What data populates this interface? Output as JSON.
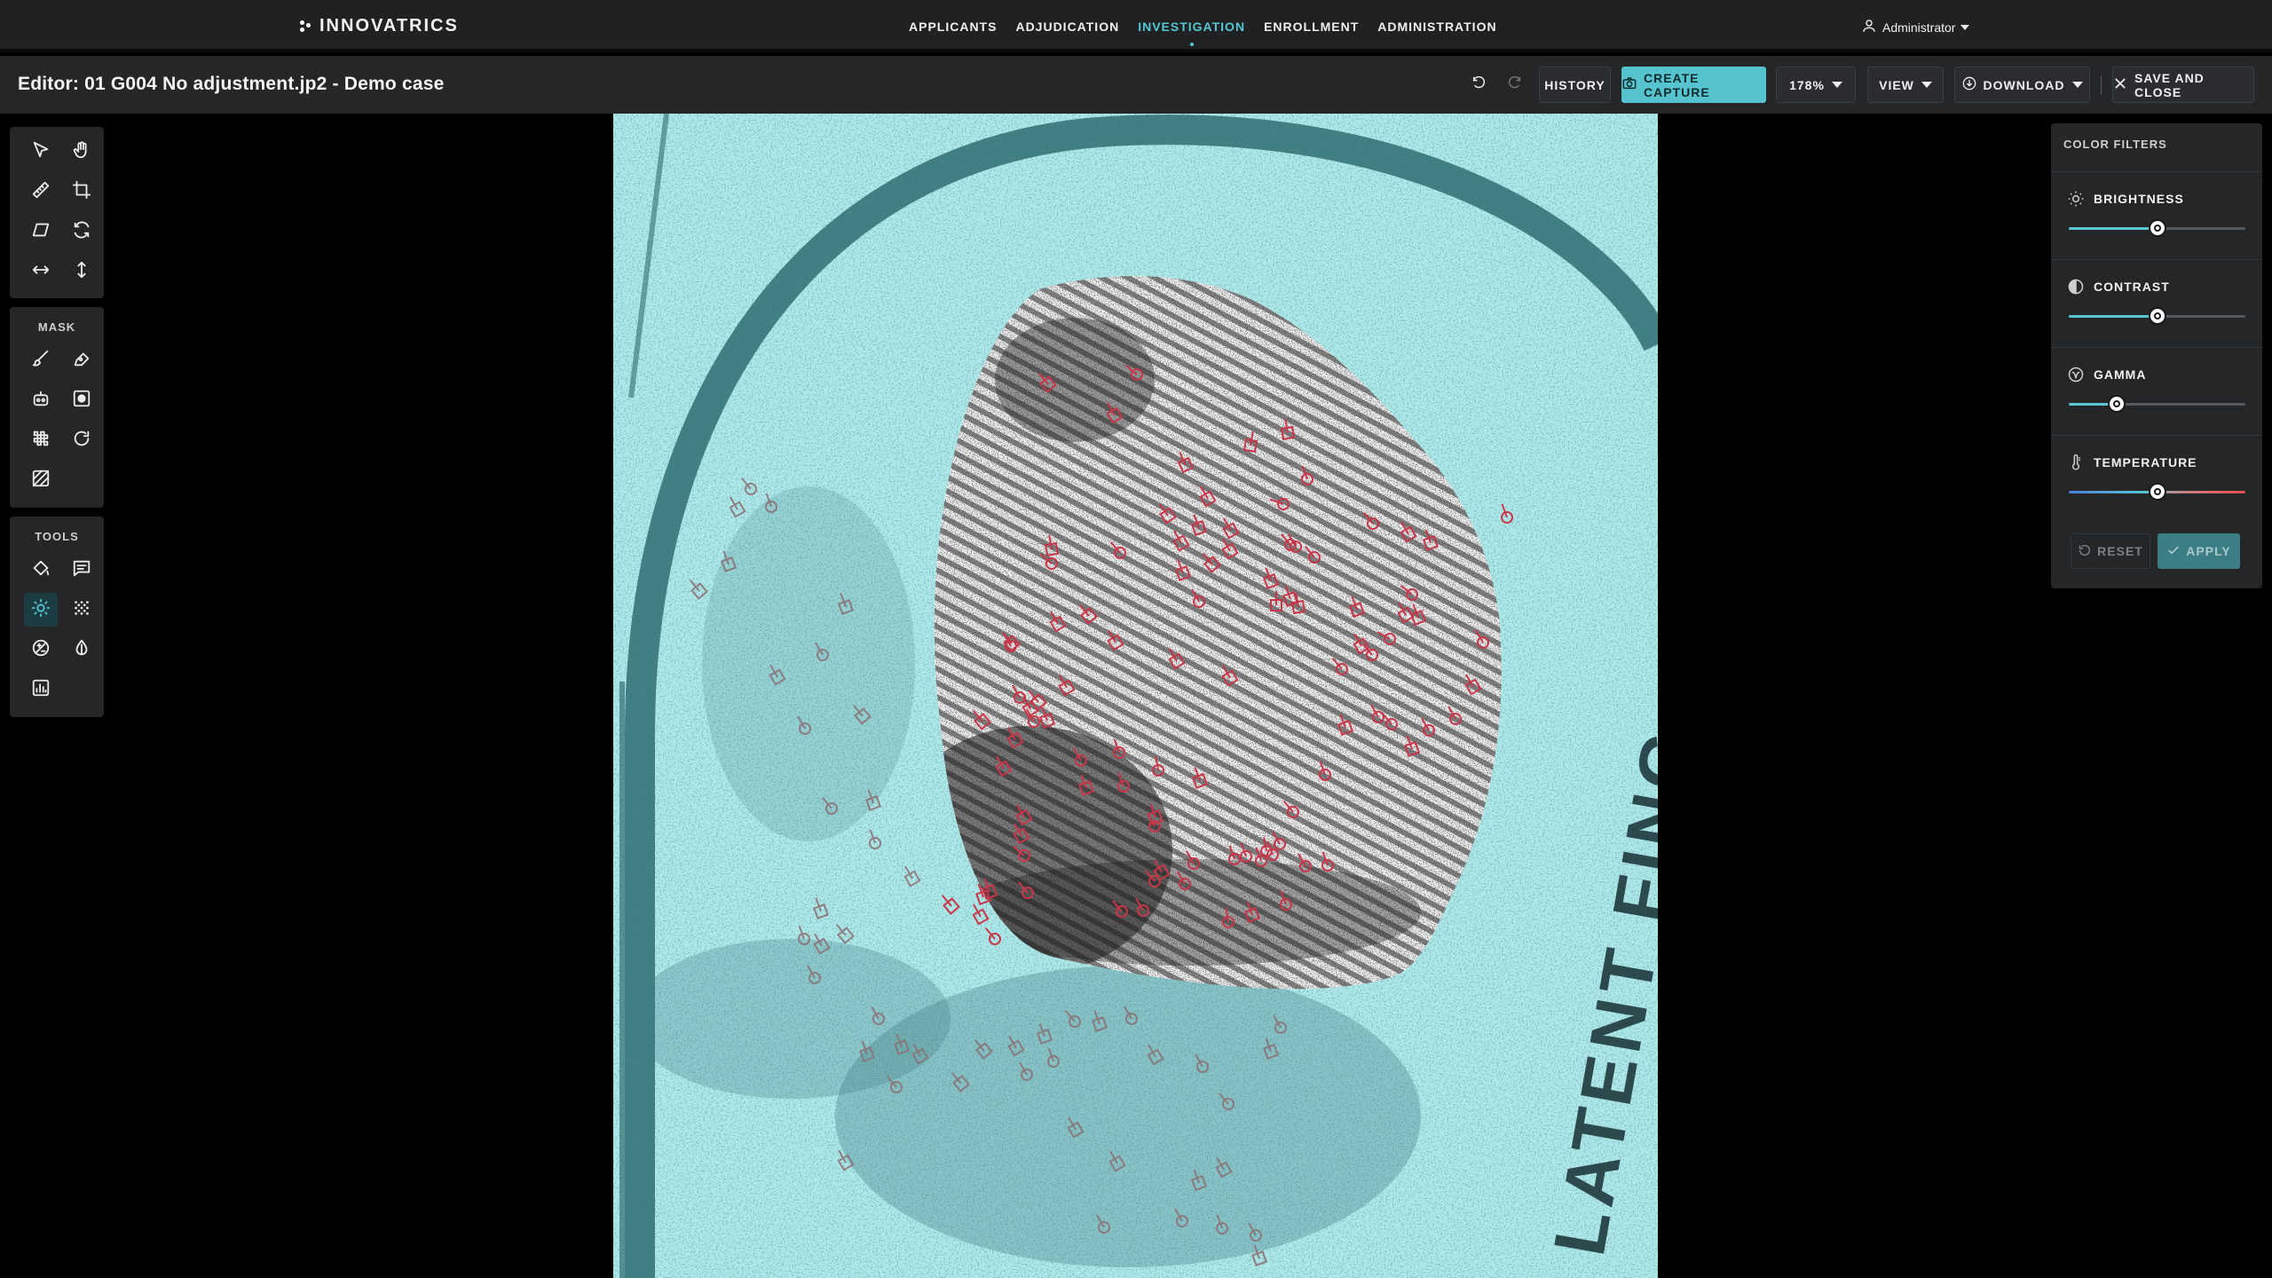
{
  "brand": {
    "name": "INNOVATRICS"
  },
  "nav": {
    "items": [
      "APPLICANTS",
      "ADJUDICATION",
      "INVESTIGATION",
      "ENROLLMENT",
      "ADMINISTRATION"
    ],
    "active": "INVESTIGATION"
  },
  "user": {
    "name": "Administrator"
  },
  "editor": {
    "title": "Editor: 01 G004 No adjustment.jp2 - Demo case",
    "history_label": "HISTORY",
    "create_capture_label": "CREATE CAPTURE",
    "zoom_label": "178%",
    "view_label": "VIEW",
    "download_label": "DOWNLOAD",
    "save_close_label": "SAVE AND CLOSE"
  },
  "left_panels": {
    "mask_label": "MASK",
    "tools_label": "TOOLS"
  },
  "color_filters": {
    "title": "COLOR FILTERS",
    "brightness": {
      "label": "BRIGHTNESS",
      "value": 0.5
    },
    "contrast": {
      "label": "CONTRAST",
      "value": 0.5
    },
    "gamma": {
      "label": "GAMMA",
      "value": 0.27
    },
    "temperature": {
      "label": "TEMPERATURE",
      "value": 0.5
    },
    "reset_label": "RESET",
    "apply_label": "APPLY"
  },
  "image_text": {
    "vertical_label": "LATENT FING"
  },
  "colors": {
    "accent": "#57c7d4",
    "minutia": "#c9364a",
    "background_tint": "#aee9ea"
  }
}
